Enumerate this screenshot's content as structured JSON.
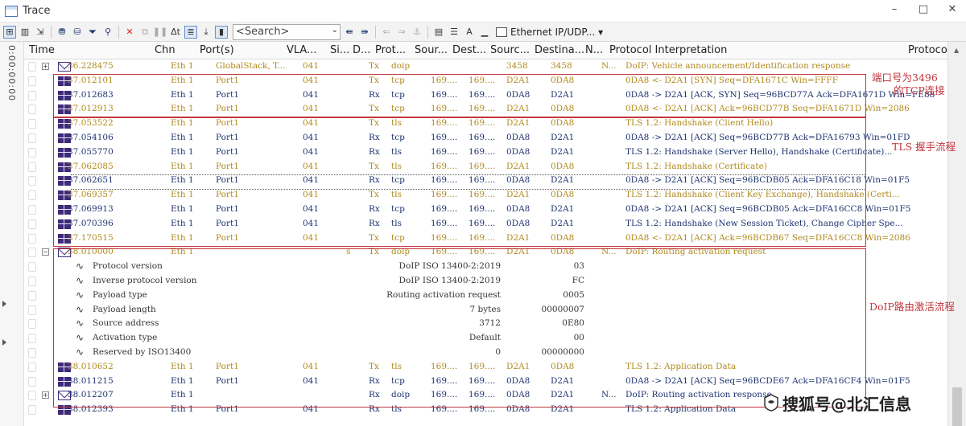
{
  "window": {
    "title": "Trace",
    "minimize": "–",
    "maximize": "□",
    "close": "✕"
  },
  "toolbar": {
    "search_placeholder": "<Search>",
    "protocol_filter": "Ethernet IP/UDP..."
  },
  "gutter": {
    "time_label": "0:00:00:00"
  },
  "columns": [
    "Time",
    "Chn",
    "Port(s)",
    "VLA...",
    "Si...",
    "D...",
    "Prot...",
    "Sour...",
    "Dest...",
    "Sourc...",
    "Destina...",
    "N...",
    "Protocol Interpretation",
    "Protocol"
  ],
  "rows": [
    {
      "time": "36.228475",
      "chn": "Eth 1",
      "port": "GlobalStack, T...",
      "vlan": "041",
      "si": "",
      "dir": "Tx",
      "proto": "doip",
      "src": "",
      "dst": "",
      "srcp": "3458",
      "dstp": "3458",
      "n": "N...",
      "info": "DoIP: Vehicle announcement/Identification response",
      "icon": "mail",
      "exp": "+"
    },
    {
      "time": "37.012101",
      "chn": "Eth 1",
      "port": "Port1",
      "vlan": "041",
      "si": "",
      "dir": "Tx",
      "proto": "tcp",
      "src": "169....",
      "dst": "169....",
      "srcp": "D2A1",
      "dstp": "0DA8",
      "n": "",
      "info": "0DA8 <- D2A1 [SYN] Seq=DFA1671C Win=FFFF",
      "icon": "grid"
    },
    {
      "time": "37.012683",
      "chn": "Eth 1",
      "port": "Port1",
      "vlan": "041",
      "si": "",
      "dir": "Rx",
      "proto": "tcp",
      "src": "169....",
      "dst": "169....",
      "srcp": "0DA8",
      "dstp": "D2A1",
      "n": "",
      "info": "0DA8 -> D2A1 [ACK, SYN] Seq=96BCD77A Ack=DFA1671D Win=FE88",
      "icon": "grid"
    },
    {
      "time": "37.012913",
      "chn": "Eth 1",
      "port": "Port1",
      "vlan": "041",
      "si": "",
      "dir": "Tx",
      "proto": "tcp",
      "src": "169....",
      "dst": "169....",
      "srcp": "D2A1",
      "dstp": "0DA8",
      "n": "",
      "info": "0DA8 <- D2A1 [ACK] Ack=96BCD77B Seq=DFA1671D Win=2086",
      "icon": "grid"
    },
    {
      "time": "37.053522",
      "chn": "Eth 1",
      "port": "Port1",
      "vlan": "041",
      "si": "",
      "dir": "Tx",
      "proto": "tls",
      "src": "169....",
      "dst": "169....",
      "srcp": "D2A1",
      "dstp": "0DA8",
      "n": "",
      "info": "TLS 1.2: Handshake (Client Hello)",
      "icon": "grid"
    },
    {
      "time": "37.054106",
      "chn": "Eth 1",
      "port": "Port1",
      "vlan": "041",
      "si": "",
      "dir": "Rx",
      "proto": "tcp",
      "src": "169....",
      "dst": "169....",
      "srcp": "0DA8",
      "dstp": "D2A1",
      "n": "",
      "info": "0DA8 -> D2A1 [ACK] Seq=96BCD77B Ack=DFA16793 Win=01FD",
      "icon": "grid"
    },
    {
      "time": "37.055770",
      "chn": "Eth 1",
      "port": "Port1",
      "vlan": "041",
      "si": "",
      "dir": "Rx",
      "proto": "tls",
      "src": "169....",
      "dst": "169....",
      "srcp": "0DA8",
      "dstp": "D2A1",
      "n": "",
      "info": "TLS 1.2: Handshake (Server Hello), Handshake (Certificate)...",
      "icon": "grid"
    },
    {
      "time": "37.062085",
      "chn": "Eth 1",
      "port": "Port1",
      "vlan": "041",
      "si": "",
      "dir": "Tx",
      "proto": "tls",
      "src": "169....",
      "dst": "169....",
      "srcp": "D2A1",
      "dstp": "0DA8",
      "n": "",
      "info": "TLS 1.2: Handshake (Certificate)",
      "icon": "grid"
    },
    {
      "time": "37.062651",
      "chn": "Eth 1",
      "port": "Port1",
      "vlan": "041",
      "si": "",
      "dir": "Rx",
      "proto": "tcp",
      "src": "169....",
      "dst": "169....",
      "srcp": "0DA8",
      "dstp": "D2A1",
      "n": "",
      "info": "0DA8 -> D2A1 [ACK] Seq=96BCDB05 Ack=DFA16C18 Win=01F5",
      "icon": "grid"
    },
    {
      "time": "37.069357",
      "chn": "Eth 1",
      "port": "Port1",
      "vlan": "041",
      "si": "",
      "dir": "Tx",
      "proto": "tls",
      "src": "169....",
      "dst": "169....",
      "srcp": "D2A1",
      "dstp": "0DA8",
      "n": "",
      "info": "TLS 1.2: Handshake (Client Key Exchange), Handshake (Certi...",
      "icon": "grid"
    },
    {
      "time": "37.069913",
      "chn": "Eth 1",
      "port": "Port1",
      "vlan": "041",
      "si": "",
      "dir": "Rx",
      "proto": "tcp",
      "src": "169....",
      "dst": "169....",
      "srcp": "0DA8",
      "dstp": "D2A1",
      "n": "",
      "info": "0DA8 -> D2A1 [ACK] Seq=96BCDB05 Ack=DFA16CC8 Win=01F5",
      "icon": "grid"
    },
    {
      "time": "37.070396",
      "chn": "Eth 1",
      "port": "Port1",
      "vlan": "041",
      "si": "",
      "dir": "Rx",
      "proto": "tls",
      "src": "169....",
      "dst": "169....",
      "srcp": "0DA8",
      "dstp": "D2A1",
      "n": "",
      "info": "TLS 1.2: Handshake (New Session Ticket), Change Cipher Spe...",
      "icon": "grid"
    },
    {
      "time": "37.170515",
      "chn": "Eth 1",
      "port": "Port1",
      "vlan": "041",
      "si": "",
      "dir": "Tx",
      "proto": "tcp",
      "src": "169....",
      "dst": "169....",
      "srcp": "D2A1",
      "dstp": "0DA8",
      "n": "",
      "info": "0DA8 <- D2A1 [ACK] Ack=96BCDB67 Seq=DFA16CC8 Win=2086",
      "icon": "grid"
    },
    {
      "time": "38.010000",
      "chn": "Eth 1",
      "port": "",
      "vlan": "",
      "si": "s",
      "dir": "Tx",
      "proto": "doip",
      "src": "169....",
      "dst": "169....",
      "srcp": "D2A1",
      "dstp": "0DA8",
      "n": "N...",
      "info": "DoIP: Routing activation request",
      "icon": "mail",
      "exp": "−"
    }
  ],
  "details": [
    {
      "name": "Protocol version",
      "value": "DoIP ISO 13400-2:2019",
      "raw": "03"
    },
    {
      "name": "Inverse protocol version",
      "value": "DoIP ISO 13400-2:2019",
      "raw": "FC"
    },
    {
      "name": "Payload type",
      "value": "Routing activation request",
      "raw": "0005"
    },
    {
      "name": "Payload length",
      "value": "7 bytes",
      "raw": "00000007"
    },
    {
      "name": "Source address",
      "value": "3712",
      "raw": "0E80"
    },
    {
      "name": "Activation type",
      "value": "Default",
      "raw": "00"
    },
    {
      "name": "Reserved by ISO13400",
      "value": "0",
      "raw": "00000000"
    }
  ],
  "rows_after": [
    {
      "time": "38.010652",
      "chn": "Eth 1",
      "port": "Port1",
      "vlan": "041",
      "si": "",
      "dir": "Tx",
      "proto": "tls",
      "src": "169....",
      "dst": "169....",
      "srcp": "D2A1",
      "dstp": "0DA8",
      "n": "",
      "info": "TLS 1.2: Application Data",
      "icon": "grid"
    },
    {
      "time": "38.011215",
      "chn": "Eth 1",
      "port": "Port1",
      "vlan": "041",
      "si": "",
      "dir": "Rx",
      "proto": "tcp",
      "src": "169....",
      "dst": "169....",
      "srcp": "0DA8",
      "dstp": "D2A1",
      "n": "",
      "info": "0DA8 -> D2A1 [ACK] Seq=96BCDE67 Ack=DFA16CF4 Win=01F5",
      "icon": "grid"
    },
    {
      "time": "38.012207",
      "chn": "Eth 1",
      "port": "",
      "vlan": "",
      "si": "",
      "dir": "Rx",
      "proto": "doip",
      "src": "169....",
      "dst": "169....",
      "srcp": "0DA8",
      "dstp": "D2A1",
      "n": "N...",
      "info": "DoIP: Routing activation response",
      "icon": "mail",
      "exp": "+"
    },
    {
      "time": "38.012393",
      "chn": "Eth 1",
      "port": "Port1",
      "vlan": "041",
      "si": "",
      "dir": "Rx",
      "proto": "tls",
      "src": "169....",
      "dst": "169....",
      "srcp": "0DA8",
      "dstp": "D2A1",
      "n": "",
      "info": "TLS 1.2: Application Data",
      "icon": "grid"
    }
  ],
  "annotations": {
    "tcp_line1": "端口号为3496",
    "tcp_line2": "的TCP连接",
    "tls": "TLS  握手流程",
    "doip": "DoIP路由激活流程"
  },
  "watermark": "搜狐号@北汇信息"
}
